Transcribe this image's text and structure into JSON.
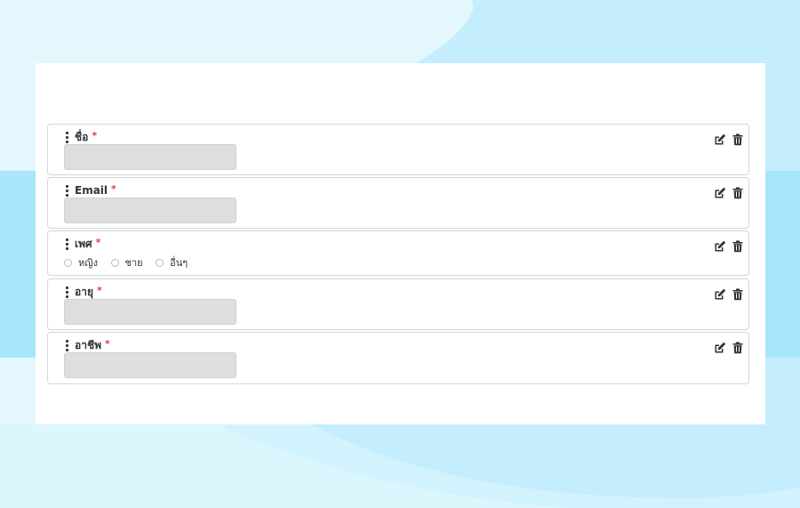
{
  "form": {
    "fields": [
      {
        "label": "ชื่อ",
        "required_mark": "*",
        "type": "text"
      },
      {
        "label": "Email",
        "required_mark": "*",
        "type": "text"
      },
      {
        "label": "เพศ",
        "required_mark": "*",
        "type": "radio",
        "options": [
          "หญิง",
          "ชาย",
          "อื่นๆ"
        ]
      },
      {
        "label": "อายุ",
        "required_mark": "*",
        "type": "text"
      },
      {
        "label": "อาชีพ",
        "required_mark": "*",
        "type": "text"
      }
    ],
    "icons": {
      "drag": "drag-handle-icon",
      "edit": "edit-icon",
      "delete": "trash-icon"
    }
  },
  "colors": {
    "background": "#e3f7fd",
    "background_band": "#a9e6fb",
    "card": "#ffffff",
    "input_fill": "#dedede",
    "required": "#e53935"
  }
}
